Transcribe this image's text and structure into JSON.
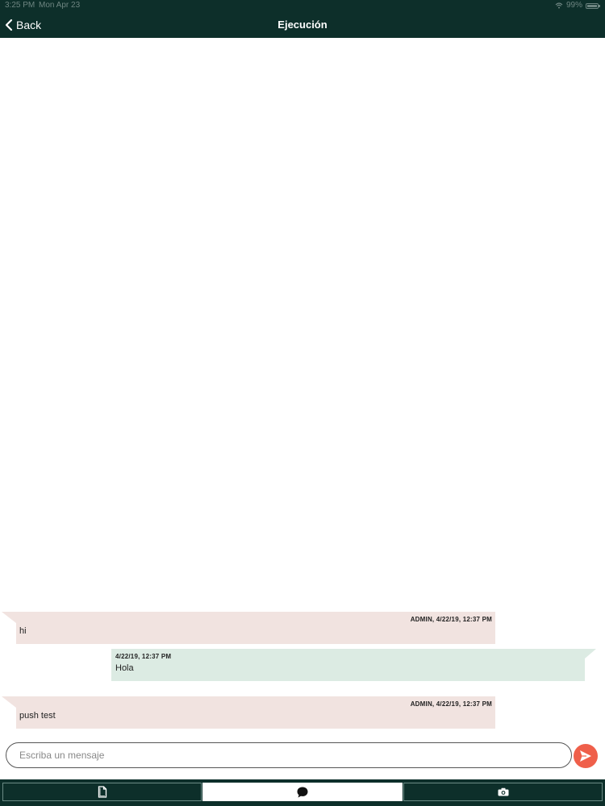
{
  "status_bar": {
    "time": "3:25 PM",
    "date": "Mon Apr 23",
    "battery": "99%",
    "battery_level": 0.99
  },
  "nav": {
    "back_label": "Back",
    "title": "Ejecución",
    "back_icon": "chevron-left-icon"
  },
  "messages": [
    {
      "direction": "incoming",
      "meta": "ADMIN, 4/22/19, 12:37 PM",
      "text": "hi"
    },
    {
      "direction": "outgoing",
      "meta": "4/22/19, 12:37 PM",
      "text": "Hola"
    },
    {
      "direction": "incoming",
      "meta": "ADMIN, 4/22/19, 12:37 PM",
      "text": "push test"
    }
  ],
  "compose": {
    "placeholder": "Escriba un mensaje",
    "value": "",
    "send_icon": "send-icon"
  },
  "tabs": [
    {
      "name": "documents",
      "icon": "document-icon",
      "selected": false
    },
    {
      "name": "chat",
      "icon": "chat-bubble-icon",
      "selected": true
    },
    {
      "name": "camera",
      "icon": "camera-icon",
      "selected": false
    }
  ],
  "colors": {
    "header_bg": "#0d2f2a",
    "incoming_bubble": "#f1e3e0",
    "outgoing_bubble": "#dcebe3",
    "send_button": "#ef5f4a"
  }
}
